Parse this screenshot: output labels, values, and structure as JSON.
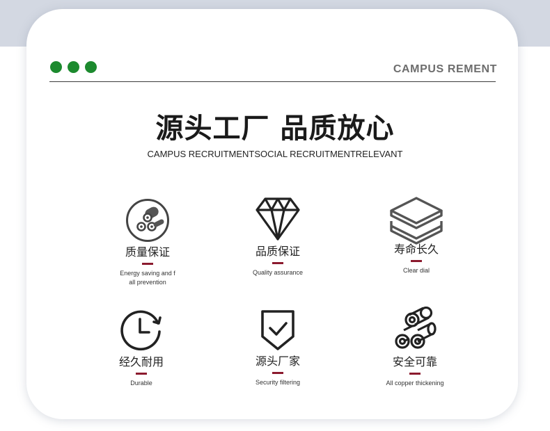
{
  "header": {
    "brand": "CAMPUS  REMENT"
  },
  "hero": {
    "title": "源头工厂 品质放心",
    "subtitle": "CAMPUS RECRUITMENTSOCIAL RECRUITMENTRELEVANT"
  },
  "features": [
    {
      "icon": "pipes-circle-icon",
      "title": "质量保证",
      "desc": "Energy saving and f all prevention"
    },
    {
      "icon": "diamond-icon",
      "title": "品质保证",
      "desc": "Quality assurance"
    },
    {
      "icon": "layers-icon",
      "title": "寿命长久",
      "desc": "Clear dial"
    },
    {
      "icon": "clock-icon",
      "title": "经久耐用",
      "desc": "Durable"
    },
    {
      "icon": "shield-check-icon",
      "title": "源头厂家",
      "desc": "Security filtering"
    },
    {
      "icon": "pipes-icon",
      "title": "安全可靠",
      "desc": "All copper thickening"
    }
  ],
  "colors": {
    "dots": "#1c8a2e",
    "accent_bar": "#8b1a2e",
    "top_band": "#d3d8e2"
  }
}
